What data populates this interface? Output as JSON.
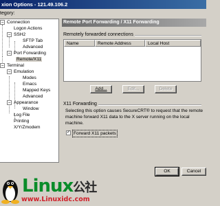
{
  "window": {
    "title": "xion Options - 121.49.106.2"
  },
  "category_label": "tegory:",
  "tree": {
    "items": [
      {
        "label": "Connection",
        "sign": "−"
      },
      {
        "label": "Logon Actions"
      },
      {
        "label": "SSH2",
        "sign": "−"
      },
      {
        "label": "SFTP Tab"
      },
      {
        "label": "Advanced"
      },
      {
        "label": "Port Forwarding",
        "sign": "−"
      },
      {
        "label": "Remote/X11"
      },
      {
        "label": "Terminal",
        "sign": "−"
      },
      {
        "label": "Emulation",
        "sign": "−"
      },
      {
        "label": "Modes"
      },
      {
        "label": "Emacs"
      },
      {
        "label": "Mapped Keys"
      },
      {
        "label": "Advanced"
      },
      {
        "label": "Appearance",
        "sign": "−"
      },
      {
        "label": "Window"
      },
      {
        "label": "Log File"
      },
      {
        "label": "Printing"
      },
      {
        "label": "X/Y/Zmodem"
      }
    ]
  },
  "panel": {
    "header": "Remote Port Forwarding / X11 Forwarding",
    "group_remote": "Remotely forwarded connections",
    "columns": [
      "Name",
      "Remote Address",
      "Local Host"
    ],
    "buttons": {
      "add": "Add...",
      "edit": "Edit...",
      "delete": "Delete"
    },
    "group_x11": "X11 Forwarding",
    "description": "Selecting this option causes SecureCRT® to request that the remote machine forward X11 data to the X server running on the local machine.",
    "checkbox_label": "Forward X11 packets",
    "checkbox_checked": "✓",
    "ok_button": "OK",
    "cancel_button": "Cancel"
  },
  "watermark": {
    "brand": "Linux",
    "brand_cn": "公社",
    "url": "www.Linuxidc.com"
  }
}
